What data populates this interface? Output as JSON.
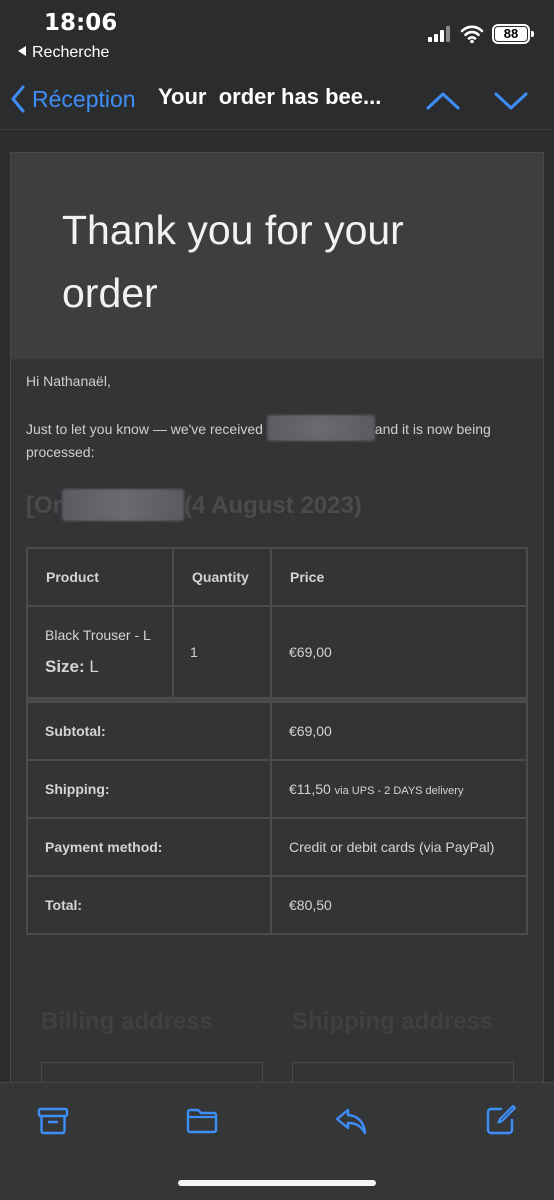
{
  "status": {
    "time": "18:06",
    "back_app": "Recherche",
    "battery": "88"
  },
  "nav": {
    "back_label": "Réception",
    "subject": "Your  order has bee..."
  },
  "email": {
    "header_title": "Thank you for your order",
    "greeting": "Hi Nathanaël,",
    "intro_before": "Just to let you know — we've received ",
    "intro_after": "and it is now being processed:",
    "order_prefix": "[Or",
    "order_date": "(4 August 2023)",
    "table": {
      "headers": [
        "Product",
        "Quantity",
        "Price"
      ],
      "item": {
        "name": "Black Trouser - L",
        "size_label": "Size:",
        "size_value": "L",
        "quantity": "1",
        "price": "€69,00"
      },
      "subtotal": {
        "label": "Subtotal:",
        "value": "€69,00"
      },
      "shipping": {
        "label": "Shipping:",
        "value": "€11,50",
        "note": "via UPS - 2 DAYS delivery"
      },
      "payment": {
        "label": "Payment method:",
        "value": "Credit or debit cards (via PayPal)"
      },
      "total": {
        "label": "Total:",
        "value": "€80,50"
      }
    },
    "billing_title": "Billing address",
    "shipping_title": "Shipping address"
  },
  "toolbar": {
    "icons": [
      "archive-icon",
      "folder-icon",
      "reply-icon",
      "compose-icon"
    ]
  },
  "colors": {
    "accent": "#3d8ef7",
    "background": "#2b2c2e",
    "card": "#333436"
  }
}
